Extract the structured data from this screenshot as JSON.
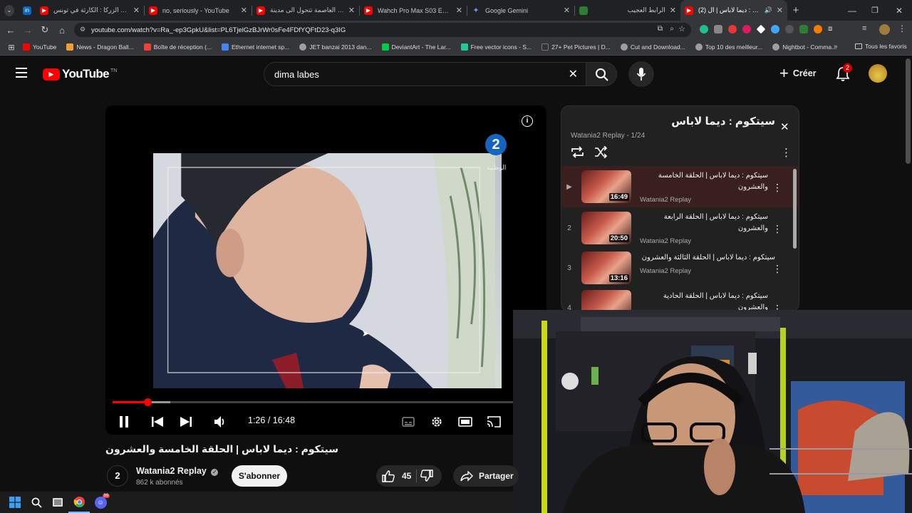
{
  "tabs": [
    {
      "title": "",
      "favicon": "linkedin-icon",
      "color": "#0a66c2"
    },
    {
      "title": "مخدر الزركا : الكارثة في تونس",
      "favicon": "youtube-icon",
      "color": "#ff0000"
    },
    {
      "title": "no, seriously - YouTube",
      "favicon": "youtube-icon",
      "color": "#ff0000"
    },
    {
      "title": "تونس العاصمة تتحول الى مدينة",
      "favicon": "youtube-icon",
      "color": "#ff0000"
    },
    {
      "title": "Wahch Pro Max S03 Episode",
      "favicon": "youtube-icon",
      "color": "#ff0000"
    },
    {
      "title": "Google Gemini",
      "favicon": "gemini-icon",
      "color": "#6f8ef7"
    },
    {
      "title": "الرابط العجيب",
      "favicon": "site-icon",
      "color": "#2e7d32"
    },
    {
      "title": "(2) سيتكوم : ديما لاباس | ال",
      "favicon": "youtube-icon",
      "color": "#ff0000",
      "active": true
    }
  ],
  "address": {
    "url": "youtube.com/watch?v=Ra_-ep3GpkU&list=PL6TjelGzBJrWr0sFe4FDfYQFtD23-q3IG"
  },
  "bookmarks": [
    {
      "label": "YouTube",
      "color": "#ff0000"
    },
    {
      "label": "News - Dragon Ball...",
      "color": "#f0a030"
    },
    {
      "label": "Boîte de réception (...",
      "color": "#ea4335"
    },
    {
      "label": "Ethernet internet sp...",
      "color": "#4285f4"
    },
    {
      "label": "JET banzai 2013 dan...",
      "color": "#9e9e9e"
    },
    {
      "label": "DeviantArt - The Lar...",
      "color": "#05cc47"
    },
    {
      "label": "Free vector icons - S...",
      "color": "#21c89b"
    },
    {
      "label": "27+ Pet Pictures | D...",
      "color": "#333333"
    },
    {
      "label": "Cut and Download...",
      "color": "#9e9e9e"
    },
    {
      "label": "Top 10 des meilleur...",
      "color": "#9e9e9e"
    },
    {
      "label": "Nightbot - Comma...",
      "color": "#9e9e9e"
    }
  ],
  "bookmarks_all": "Tous les favoris",
  "youtube": {
    "logo": "YouTube",
    "logo_region": "TN",
    "search_value": "dima labes",
    "create_label": "Créer",
    "notification_count": "2"
  },
  "player": {
    "current_time": "1:26",
    "separator": " / ",
    "duration": "16:48",
    "progress": 0.088,
    "buffered": 0.145,
    "channel_watermark": "الوطنية"
  },
  "playlist": {
    "title": "سيتكوم : ديما لاباس",
    "subtitle": "Watania2 Replay - 1/24",
    "items": [
      {
        "index": "▶",
        "title": "سيتكوم : ديما لاباس | الحلقة الخامسة والعشرون",
        "channel": "Watania2 Replay",
        "duration": "16:49",
        "active": true
      },
      {
        "index": "2",
        "title": "سيتكوم : ديما لاباس | الحلقة الرابعة والعشرون",
        "channel": "Watania2 Replay",
        "duration": "20:50"
      },
      {
        "index": "3",
        "title": "سيتكوم : ديما لاباس | الحلقة الثالثة والعشرون",
        "channel": "Watania2 Replay",
        "duration": "13:16"
      },
      {
        "index": "4",
        "title": "سيتكوم : ديما لاباس | الحلقة الحادية والعشرون",
        "channel": "",
        "duration": ""
      }
    ]
  },
  "video": {
    "title": "سيتكوم : ديما لاباس | الحلقة الخامسة والعشرون",
    "channel": "Watania2 Replay",
    "subscribers": "862 k abonnés",
    "subscribe_label": "S'abonner",
    "likes": "45",
    "share_label": "Partager"
  },
  "colors": {
    "accent": "#ff0000",
    "background": "#0f0f0f",
    "panel": "#212121"
  }
}
